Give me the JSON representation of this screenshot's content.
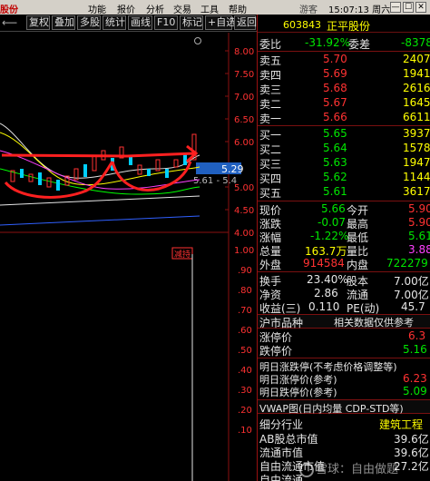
{
  "menubar": {
    "app_title": "股份",
    "items": [
      "功能",
      "报价",
      "分析",
      "交易",
      "工具",
      "帮助"
    ],
    "center_text": "游客",
    "clock": "15:07:13 周六",
    "controls": [
      "—",
      "☐",
      "✕"
    ]
  },
  "toolbar": {
    "back_glyph": "⟵",
    "buttons": [
      "复权",
      "叠加",
      "多股",
      "统计",
      "画线",
      "F10",
      "标记",
      "+自选",
      "返回"
    ]
  },
  "chart": {
    "price_ticks": [
      "8.00",
      "7.50",
      "7.00",
      "6.50",
      "6.00",
      "5.50",
      "5.00",
      "4.50",
      "4.00"
    ],
    "current_price_tag": "5.29",
    "stop_label": "5.61 - 5.4",
    "event_tag": "减持",
    "volume_ticks": [
      "1.00",
      ".90",
      ".80",
      ".70",
      ".60",
      ".50",
      ".40",
      ".30",
      ".20",
      ".10"
    ],
    "colors": {
      "annotation": "#ff2020",
      "price_tag": "#2060c0"
    }
  },
  "panel": {
    "code": "603843",
    "name": "正平股份",
    "webi": {
      "label1": "委比",
      "value1": "-31.92%",
      "label2": "委差",
      "value2": "-8378"
    },
    "asks": [
      {
        "label": "卖五",
        "price": "5.70",
        "vol": "2407"
      },
      {
        "label": "卖四",
        "price": "5.69",
        "vol": "1941"
      },
      {
        "label": "卖三",
        "price": "5.68",
        "vol": "2616"
      },
      {
        "label": "卖二",
        "price": "5.67",
        "vol": "1645"
      },
      {
        "label": "卖一",
        "price": "5.66",
        "vol": "6611"
      }
    ],
    "bids": [
      {
        "label": "买一",
        "price": "5.65",
        "vol": "3937"
      },
      {
        "label": "买二",
        "price": "5.64",
        "vol": "1578"
      },
      {
        "label": "买三",
        "price": "5.63",
        "vol": "1947"
      },
      {
        "label": "买四",
        "price": "5.62",
        "vol": "1144"
      },
      {
        "label": "买五",
        "price": "5.61",
        "vol": "3617"
      }
    ],
    "stats": [
      {
        "l1": "现价",
        "v1": "5.66",
        "c1": "green",
        "l2": "今开",
        "v2": "5.90",
        "c2": "red"
      },
      {
        "l1": "涨跌",
        "v1": "-0.07",
        "c1": "green",
        "l2": "最高",
        "v2": "5.90",
        "c2": "red"
      },
      {
        "l1": "涨幅",
        "v1": "-1.22%",
        "c1": "green",
        "l2": "最低",
        "v2": "5.61",
        "c2": "green"
      },
      {
        "l1": "总量",
        "v1": "163.7万",
        "c1": "yellow",
        "l2": "量比",
        "v2": "3.88",
        "c2": "magenta"
      },
      {
        "l1": "外盘",
        "v1": "914584",
        "c1": "red",
        "l2": "内盘",
        "v2": "722279",
        "c2": "green"
      }
    ],
    "stats2": [
      {
        "l1": "换手",
        "v1": "23.40%",
        "l2": "股本",
        "v2": "7.00亿"
      },
      {
        "l1": "净资",
        "v1": "2.86",
        "l2": "流通",
        "v2": "7.00亿"
      },
      {
        "l1": "收益(三)",
        "v1": "0.110",
        "l2": "PE(动)",
        "v2": "45.7"
      }
    ],
    "section_hk": {
      "left": "沪市品种",
      "right": "相关数据仅供参考"
    },
    "limit": [
      {
        "label": "涨停价",
        "value": "6.3",
        "color": "red"
      },
      {
        "label": "跌停价",
        "value": "5.16",
        "color": "green"
      }
    ],
    "next_day_title": "明日涨跌停(不考虑价格调整等)",
    "next_day": [
      {
        "label": "明日涨停价(参考)",
        "value": "6.23",
        "color": "red"
      },
      {
        "label": "明日跌停价(参考)",
        "value": "5.09",
        "color": "green"
      }
    ],
    "vwap_title": "VWAP图(日内均量 CDP-STD等)",
    "industry": {
      "label": "细分行业",
      "value": "建筑工程"
    },
    "bottom": [
      {
        "label": "AB股总市值",
        "value": "39.6亿"
      },
      {
        "label": "流通市值",
        "value": "39.6亿"
      },
      {
        "label": "自由流通市值",
        "value": "27.2亿"
      },
      {
        "label": "自由流通",
        "value": ""
      }
    ],
    "watermark": "雪球：自由做题"
  }
}
